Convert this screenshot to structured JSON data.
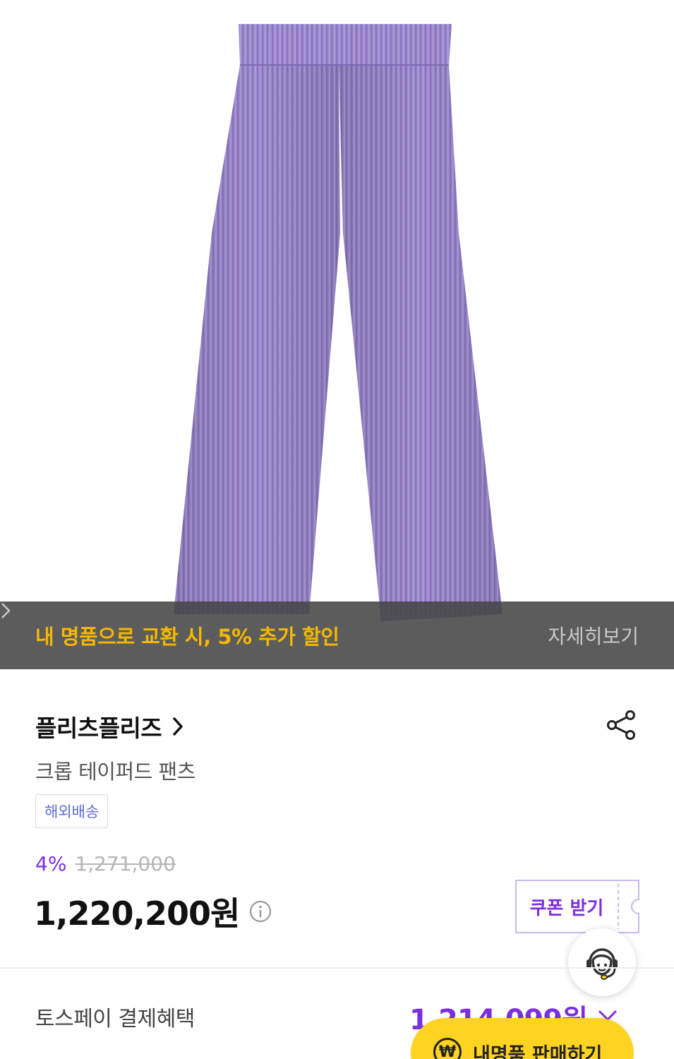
{
  "hero": {
    "image_desc_icon": "product-photo-pleated-pants",
    "pants_color": "#9d88cf"
  },
  "promo": {
    "text": "내 명품으로 교환 시, 5% 추가 할인",
    "more_label": "자세히보기",
    "text_color": "#f5b800"
  },
  "product": {
    "brand": "플리츠플리즈",
    "name": "크롭 테이퍼드 팬츠",
    "shipping_badge": "해외배송",
    "discount_percent": "4%",
    "original_price": "1,271,000",
    "price": "1,220,200원",
    "coupon_label": "쿠폰 받기"
  },
  "payment": {
    "label": "토스페이 결제혜택",
    "price": "1,214,099원"
  },
  "sell_button": {
    "icon_text": "₩",
    "label": "내명품 판매하기"
  },
  "colors": {
    "accent": "#7b2fe0",
    "badge_text": "#5b6ad6",
    "sell_button": "#ffd321"
  }
}
